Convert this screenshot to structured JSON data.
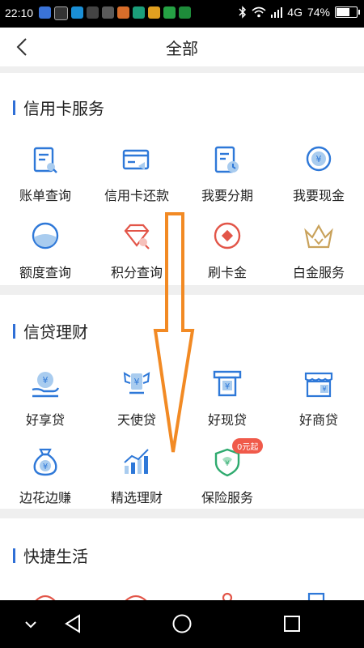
{
  "status_bar": {
    "time": "22:10",
    "network": "4G",
    "battery": "74%",
    "battery_level": 0.74
  },
  "header": {
    "title": "全部"
  },
  "sections": [
    {
      "title": "信用卡服务",
      "items": [
        {
          "label": "账单查询",
          "icon": "bill-query-icon"
        },
        {
          "label": "信用卡还款",
          "icon": "card-repay-icon"
        },
        {
          "label": "我要分期",
          "icon": "installment-icon"
        },
        {
          "label": "我要现金",
          "icon": "cash-icon"
        },
        {
          "label": "额度查询",
          "icon": "limit-query-icon"
        },
        {
          "label": "积分查询",
          "icon": "points-query-icon"
        },
        {
          "label": "刷卡金",
          "icon": "swipe-reward-icon"
        },
        {
          "label": "白金服务",
          "icon": "crown-icon"
        }
      ]
    },
    {
      "title": "信贷理财",
      "items": [
        {
          "label": "好享贷",
          "icon": "loan-hand-icon"
        },
        {
          "label": "天使贷",
          "icon": "angel-loan-icon"
        },
        {
          "label": "好现贷",
          "icon": "cash-loan-icon"
        },
        {
          "label": "好商贷",
          "icon": "shop-loan-icon"
        },
        {
          "label": "边花边赚",
          "icon": "money-bag-icon"
        },
        {
          "label": "精选理财",
          "icon": "bar-chart-icon"
        },
        {
          "label": "保险服务",
          "icon": "shield-icon",
          "badge": "0元起"
        }
      ]
    },
    {
      "title": "快捷生活"
    }
  ],
  "colors": {
    "accent": "#2f6fd6",
    "icon_blue": "#2e78d8",
    "red": "#e25548",
    "gold": "#c9a25b",
    "green": "#2eaa6e",
    "arrow": "#f28a24"
  }
}
